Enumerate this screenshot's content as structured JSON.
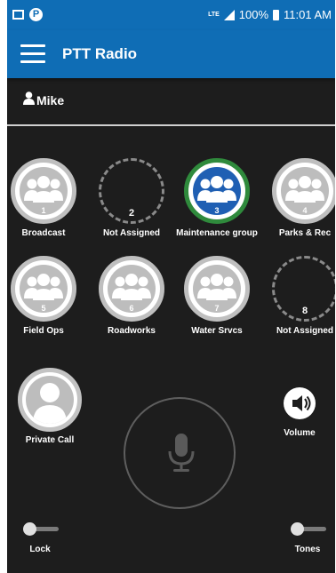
{
  "status_bar": {
    "network": "LTE",
    "battery": "100%",
    "time": "11:01 AM",
    "notification_icons": [
      "image-icon",
      "p-icon"
    ]
  },
  "app_bar": {
    "title": "PTT Radio"
  },
  "user": {
    "name": "Mike"
  },
  "talkgroups": [
    {
      "number": "1",
      "label": "Broadcast",
      "state": "assigned"
    },
    {
      "number": "2",
      "label": "Not Assigned",
      "state": "empty"
    },
    {
      "number": "3",
      "label": "Maintenance group",
      "state": "selected"
    },
    {
      "number": "4",
      "label": "Parks & Rec",
      "state": "assigned"
    },
    {
      "number": "5",
      "label": "Field Ops",
      "state": "assigned"
    },
    {
      "number": "6",
      "label": "Roadworks",
      "state": "assigned"
    },
    {
      "number": "7",
      "label": "Water Srvcs",
      "state": "assigned"
    },
    {
      "number": "8",
      "label": "Not Assigned",
      "state": "empty"
    }
  ],
  "controls": {
    "private_call": "Private Call",
    "volume": "Volume",
    "lock": "Lock",
    "tones": "Tones",
    "lock_on": false,
    "tones_on": false
  },
  "colors": {
    "app_blue": "#0f6db5",
    "background": "#1d1d1d",
    "selected_ring": "#2f8a3c",
    "selected_fill": "#1f5fb3"
  }
}
